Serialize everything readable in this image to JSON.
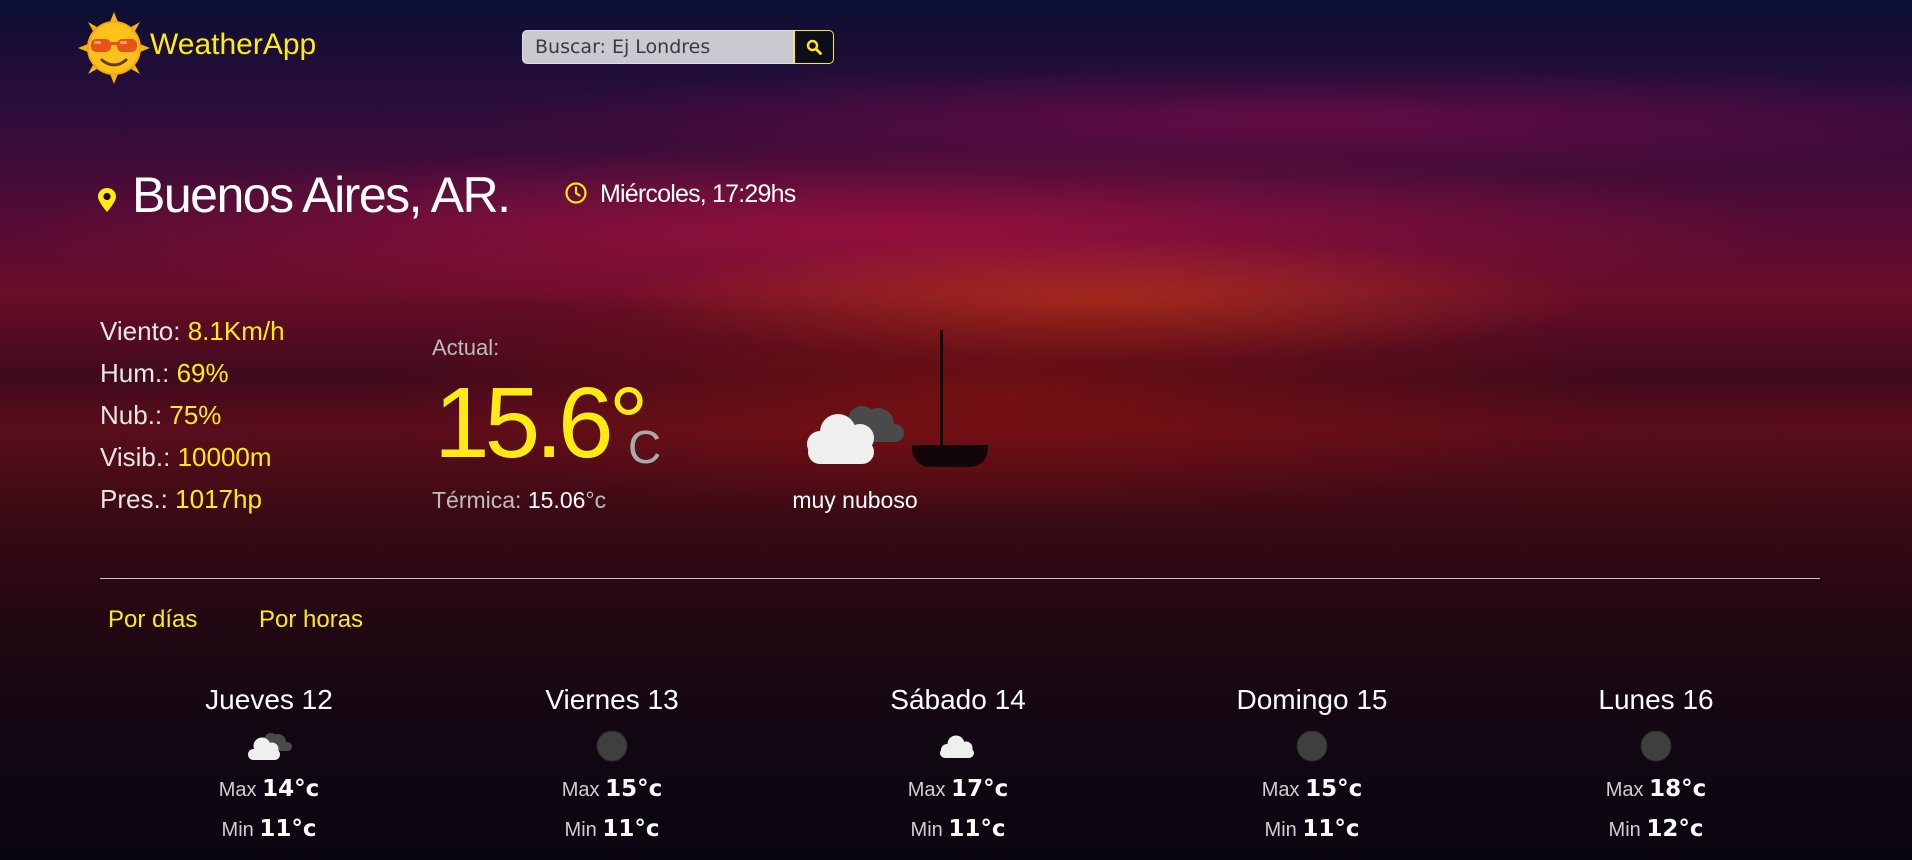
{
  "app": {
    "title": "WeatherApp"
  },
  "search": {
    "placeholder": "Buscar: Ej Londres"
  },
  "location": {
    "city": "Buenos Aires, AR.",
    "datetime": "Miércoles, 17:29hs"
  },
  "stats": [
    {
      "label": "Viento:",
      "value": "8.1Km/h"
    },
    {
      "label": "Hum.:",
      "value": "69%"
    },
    {
      "label": "Nub.:",
      "value": "75%"
    },
    {
      "label": "Visib.:",
      "value": "10000m"
    },
    {
      "label": "Pres.:",
      "value": "1017hp"
    }
  ],
  "current": {
    "label": "Actual:",
    "temp": "15.6°",
    "unit": "C",
    "feels_label": "Térmica:",
    "feels_value": "15.06",
    "feels_unit": "°c",
    "description": "muy nuboso",
    "icon": "cloudy-icon"
  },
  "tabs": {
    "days": "Por días",
    "hours": "Por horas"
  },
  "forecast": [
    {
      "day": "Jueves 12",
      "icon": "cloudy-icon",
      "max_label": "Max",
      "max": "14°c",
      "min_label": "Min",
      "min": "11°c"
    },
    {
      "day": "Viernes 13",
      "icon": "overcast-icon",
      "max_label": "Max",
      "max": "15°c",
      "min_label": "Min",
      "min": "11°c"
    },
    {
      "day": "Sábado 14",
      "icon": "cloud-icon",
      "max_label": "Max",
      "max": "17°c",
      "min_label": "Min",
      "min": "11°c"
    },
    {
      "day": "Domingo 15",
      "icon": "overcast-icon",
      "max_label": "Max",
      "max": "15°c",
      "min_label": "Min",
      "min": "11°c"
    },
    {
      "day": "Lunes 16",
      "icon": "overcast-icon",
      "max_label": "Max",
      "max": "18°c",
      "min_label": "Min",
      "min": "12°c"
    }
  ],
  "colors": {
    "accent": "#ffeb12",
    "text": "#ffffff",
    "muted": "#bdbdbd"
  }
}
